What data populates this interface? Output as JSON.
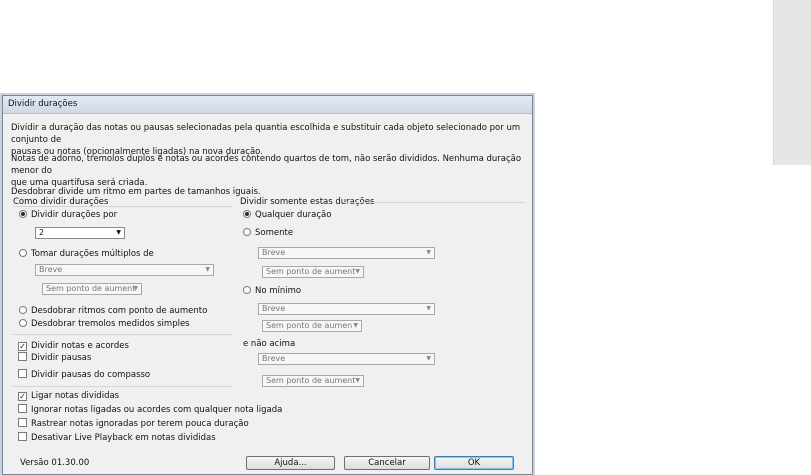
{
  "dialog": {
    "title": "Dividir durações",
    "desc1a": "Dividir a duração das notas ou pausas selecionadas pela quantia escolhida e substituir cada objeto selecionado por um conjunto de",
    "desc1b": "pausas ou notas (opcionalmente ligadas) na nova duração.",
    "desc2a": "Notas de adorno, tremolos duplos e notas ou acordes contendo quartos de tom, não serão divididos. Nenhuma duração menor do",
    "desc2b": "que uma quartifusa será criada.",
    "desc3": "Desdobrar divide um ritmo em partes de tamanhos iguais."
  },
  "how_to_divide": {
    "title": "Como dividir durações",
    "opt_divide_by": "Dividir durações por",
    "divide_by_value": "2",
    "opt_multiples": "Tomar durações múltiplos de",
    "multiples_value": "Breve",
    "multiples_dot": "Sem ponto de aument",
    "opt_unfold_dotted": "Desdobrar ritmos com ponto de aumento",
    "opt_unfold_tremolo": "Desdobrar tremolos medidos simples"
  },
  "only_these": {
    "title": "Dividir somente estas durações",
    "opt_any": "Qualquer duração",
    "opt_only": "Somente",
    "only_value": "Breve",
    "only_dot": "Sem ponto de aument",
    "opt_min": "No mínimo",
    "min_value": "Breve",
    "min_dot": "Sem ponto de aumen",
    "not_above_label": "e não acima",
    "above_value": "Breve",
    "above_dot": "Sem ponto de aument"
  },
  "checks": {
    "notes_chords": "Dividir notas e acordes",
    "rests": "Dividir pausas",
    "measure_rests": "Dividir pausas do compasso",
    "tie": "Ligar notas divididas",
    "ignore_tied": "Ignorar notas ligadas ou acordes com qualquer nota ligada",
    "highlight": "Rastrear notas ignoradas por terem pouca duração",
    "disable_playback": "Desativar Live Playback em notas divididas"
  },
  "footer": {
    "version": "Versão 01.30.00",
    "help": "Ajuda...",
    "cancel": "Cancelar",
    "ok": "OK"
  }
}
